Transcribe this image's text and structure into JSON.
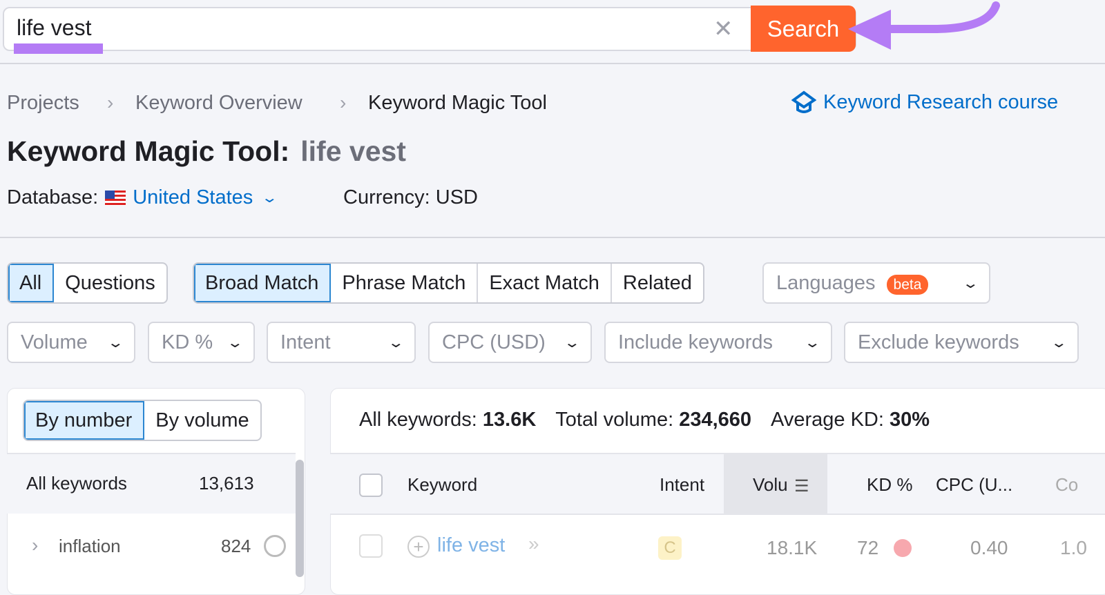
{
  "search": {
    "value": "life vest",
    "button": "Search"
  },
  "breadcrumb": [
    "Projects",
    "Keyword Overview",
    "Keyword Magic Tool"
  ],
  "course_link": "Keyword Research course",
  "title": {
    "tool": "Keyword Magic Tool:",
    "keyword": "life vest"
  },
  "database": {
    "label": "Database:",
    "value": "United States"
  },
  "currency": "Currency: USD",
  "tabs_type": [
    "All",
    "Questions"
  ],
  "tabs_match": [
    "Broad Match",
    "Phrase Match",
    "Exact Match",
    "Related"
  ],
  "languages": {
    "label": "Languages",
    "badge": "beta"
  },
  "filters": [
    "Volume",
    "KD %",
    "Intent",
    "CPC (USD)",
    "Include keywords",
    "Exclude keywords"
  ],
  "group_toggle": [
    "By number",
    "By volume"
  ],
  "groups": [
    {
      "label": "All keywords",
      "count": "13,613"
    },
    {
      "label": "inflation",
      "count": "824"
    }
  ],
  "stats": {
    "all_label": "All keywords:",
    "all": "13.6K",
    "vol_label": "Total volume:",
    "vol": "234,660",
    "kd_label": "Average KD:",
    "kd": "30%"
  },
  "columns": [
    "Keyword",
    "Intent",
    "Volu",
    "KD %",
    "CPC (U...",
    "Co"
  ],
  "rows": [
    {
      "keyword": "life vest",
      "intent": "C",
      "volume": "18.1K",
      "kd": "72",
      "cpc": "0.40",
      "com": "1.0"
    }
  ],
  "colors": {
    "accent": "#ff642d",
    "link": "#006dca",
    "annotation": "#b47cf5"
  }
}
